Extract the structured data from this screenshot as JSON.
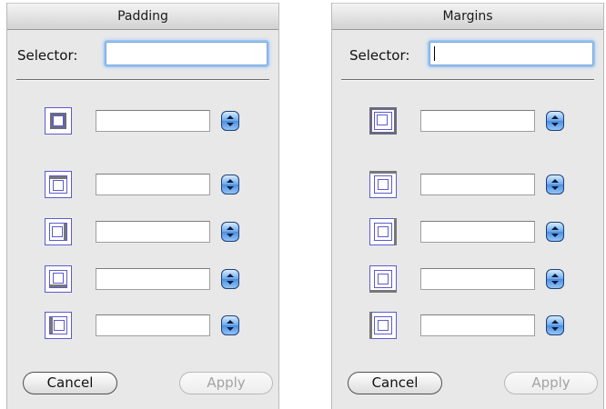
{
  "panels": [
    {
      "title": "Padding",
      "selector_label": "Selector:",
      "selector_value": "",
      "sides": [
        {
          "icon": "all-sides-icon",
          "value": ""
        },
        {
          "icon": "top-side-icon",
          "value": ""
        },
        {
          "icon": "right-side-icon",
          "value": ""
        },
        {
          "icon": "bottom-side-icon",
          "value": ""
        },
        {
          "icon": "left-side-icon",
          "value": ""
        }
      ],
      "cancel_label": "Cancel",
      "apply_label": "Apply"
    },
    {
      "title": "Margins",
      "selector_label": "Selector:",
      "selector_value": "",
      "sides": [
        {
          "icon": "all-sides-icon",
          "value": ""
        },
        {
          "icon": "top-side-icon",
          "value": ""
        },
        {
          "icon": "right-side-icon",
          "value": ""
        },
        {
          "icon": "bottom-side-icon",
          "value": ""
        },
        {
          "icon": "left-side-icon",
          "value": ""
        }
      ],
      "cancel_label": "Cancel",
      "apply_label": "Apply"
    }
  ],
  "colors": {
    "panel_bg": "#e8e8e8",
    "focus_ring": "#9cc3ee",
    "icon_line": "#5b5bd0",
    "stepper": "#4a8ee0",
    "apply_disabled_text": "#a3a3a3"
  }
}
